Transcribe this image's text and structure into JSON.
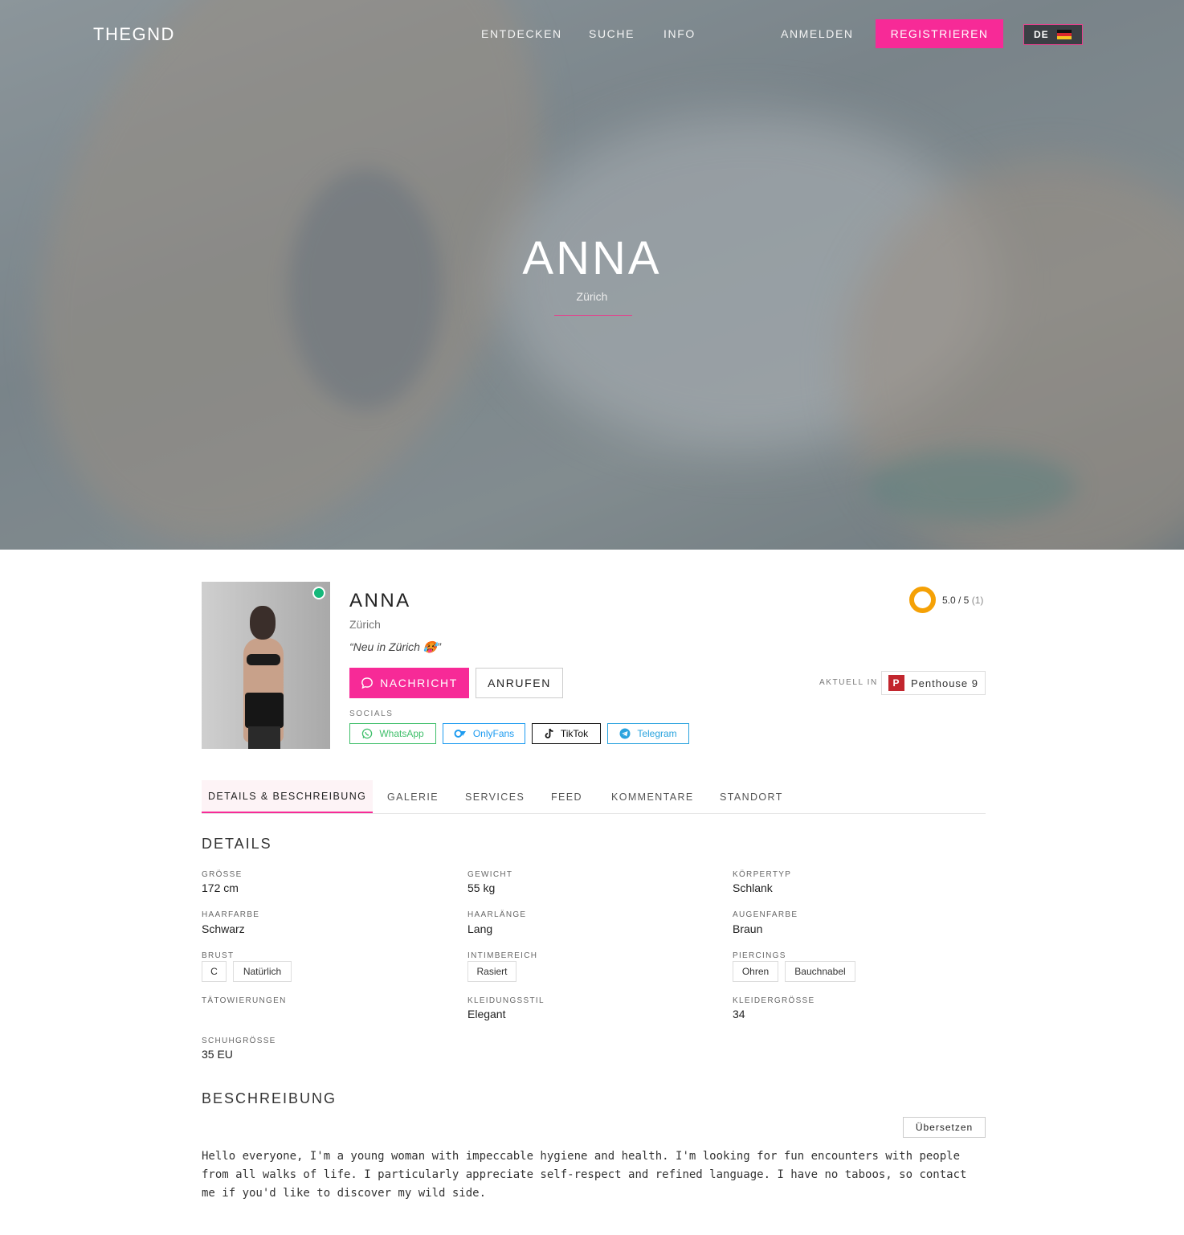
{
  "nav": {
    "logo": "THEGND",
    "links": [
      "ENTDECKEN",
      "SUCHE",
      "INFO"
    ],
    "login": "ANMELDEN",
    "register": "REGISTRIEREN",
    "language": "DE"
  },
  "hero": {
    "name": "ANNA",
    "city": "Zürich"
  },
  "profile": {
    "name": "ANNA",
    "city": "Zürich",
    "quote": "“Neu in Zürich 🥵”",
    "online": true,
    "rating": {
      "value": "5.0 / 5",
      "count": "(1)"
    },
    "message_label": "NACHRICHT",
    "call_label": "ANRUFEN",
    "current_label": "AKTUELL IN",
    "current_place": "Penthouse 9",
    "socials_label": "SOCIALS",
    "socials": [
      "WhatsApp",
      "OnlyFans",
      "TikTok",
      "Telegram"
    ]
  },
  "tabs": [
    "DETAILS & BESCHREIBUNG",
    "GALERIE",
    "SERVICES",
    "FEED",
    "KOMMENTARE",
    "STANDORT"
  ],
  "details": {
    "title": "DETAILS",
    "groesse_label": "GRÖSSE",
    "groesse": "172 cm",
    "gewicht_label": "GEWICHT",
    "gewicht": "55 kg",
    "koerpertyp_label": "KÖRPERTYP",
    "koerpertyp": "Schlank",
    "haarfarbe_label": "HAARFARBE",
    "haarfarbe": "Schwarz",
    "haarlaenge_label": "HAARLÄNGE",
    "haarlaenge": "Lang",
    "augenfarbe_label": "AUGENFARBE",
    "augenfarbe": "Braun",
    "brust_label": "BRUST",
    "brust": [
      "C",
      "Natürlich"
    ],
    "intim_label": "INTIMBEREICH",
    "intim": [
      "Rasiert"
    ],
    "piercings_label": "PIERCINGS",
    "piercings": [
      "Ohren",
      "Bauchnabel"
    ],
    "tattoo_label": "TÄTOWIERUNGEN",
    "kleidungsstil_label": "KLEIDUNGSSTIL",
    "kleidungsstil": "Elegant",
    "kleidergroesse_label": "KLEIDERGRÖSSE",
    "kleidergroesse": "34",
    "schuh_label": "SCHUHGRÖSSE",
    "schuh": "35 EU"
  },
  "description": {
    "title": "BESCHREIBUNG",
    "translate": "Übersetzen",
    "text": "Hello everyone, I'm a young woman with impeccable hygiene and health. I'm looking for fun encounters with people from all walks of life. I particularly appreciate self-respect and refined language. I have no taboos, so contact me if you'd like to discover my wild side."
  },
  "colors": {
    "accent": "#f72a97",
    "rating": "#f5a106",
    "online": "#14b87a"
  }
}
